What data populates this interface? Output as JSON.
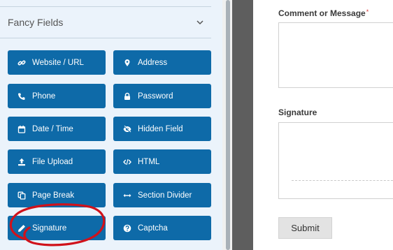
{
  "sidebar": {
    "section_title": "Fancy Fields",
    "fields": [
      {
        "label": "Website / URL",
        "icon": "link-icon"
      },
      {
        "label": "Address",
        "icon": "map-pin-icon"
      },
      {
        "label": "Phone",
        "icon": "phone-icon"
      },
      {
        "label": "Password",
        "icon": "lock-icon"
      },
      {
        "label": "Date / Time",
        "icon": "calendar-icon"
      },
      {
        "label": "Hidden Field",
        "icon": "eye-slash-icon"
      },
      {
        "label": "File Upload",
        "icon": "upload-icon"
      },
      {
        "label": "HTML",
        "icon": "code-icon"
      },
      {
        "label": "Page Break",
        "icon": "copy-icon"
      },
      {
        "label": "Section Divider",
        "icon": "arrows-h-icon"
      },
      {
        "label": "Signature",
        "icon": "pen-icon"
      },
      {
        "label": "Captcha",
        "icon": "question-circle-icon"
      }
    ]
  },
  "form": {
    "comment_label": "Comment or Message",
    "required_mark": "*",
    "signature_label": "Signature",
    "submit_label": "Submit"
  },
  "colors": {
    "field_button": "#0e6aa8",
    "panel_bg": "#ebf3fb",
    "annotation_red": "#d0121b"
  }
}
